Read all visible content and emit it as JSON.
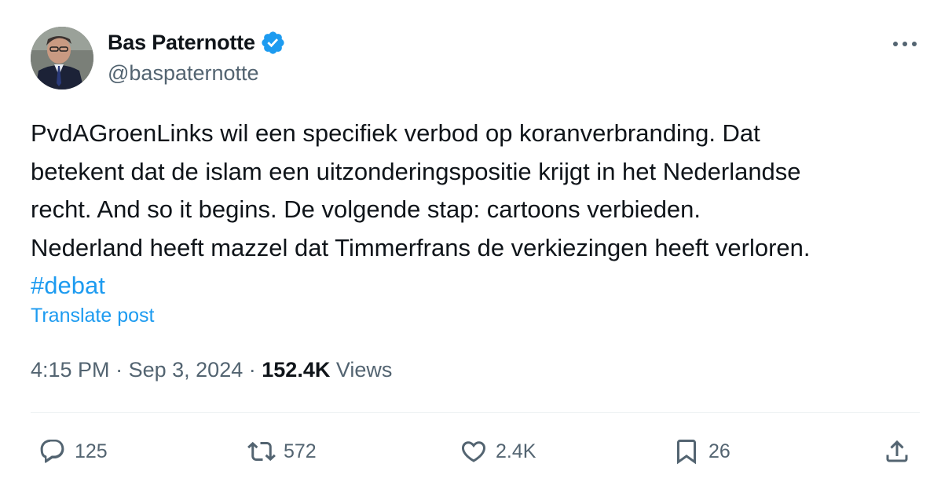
{
  "author": {
    "name": "Bas Paternotte",
    "handle": "@baspaternotte",
    "verified": true
  },
  "post": {
    "lines": [
      "PvdAGroenLinks wil een specifiek verbod op koranverbranding. Dat",
      "betekent dat de islam een uitzonderingspositie krijgt in het Nederlandse",
      "recht. And so it begins. De volgende stap: cartoons verbieden.",
      "Nederland heeft mazzel dat Timmerfrans de verkiezingen heeft verloren."
    ],
    "hashtag": "#debat",
    "translate_label": "Translate post"
  },
  "meta": {
    "time": "4:15 PM",
    "separator": "·",
    "date": "Sep 3, 2024",
    "views_count": "152.4K",
    "views_label": "Views"
  },
  "actions": {
    "replies": "125",
    "reposts": "572",
    "likes": "2.4K",
    "bookmarks": "26"
  },
  "colors": {
    "accent": "#1d9bf0",
    "text_primary": "#0f1419",
    "text_secondary": "#536471"
  },
  "icons": [
    "verified-badge-icon",
    "more-icon",
    "reply-icon",
    "repost-icon",
    "like-icon",
    "bookmark-icon",
    "share-icon"
  ]
}
